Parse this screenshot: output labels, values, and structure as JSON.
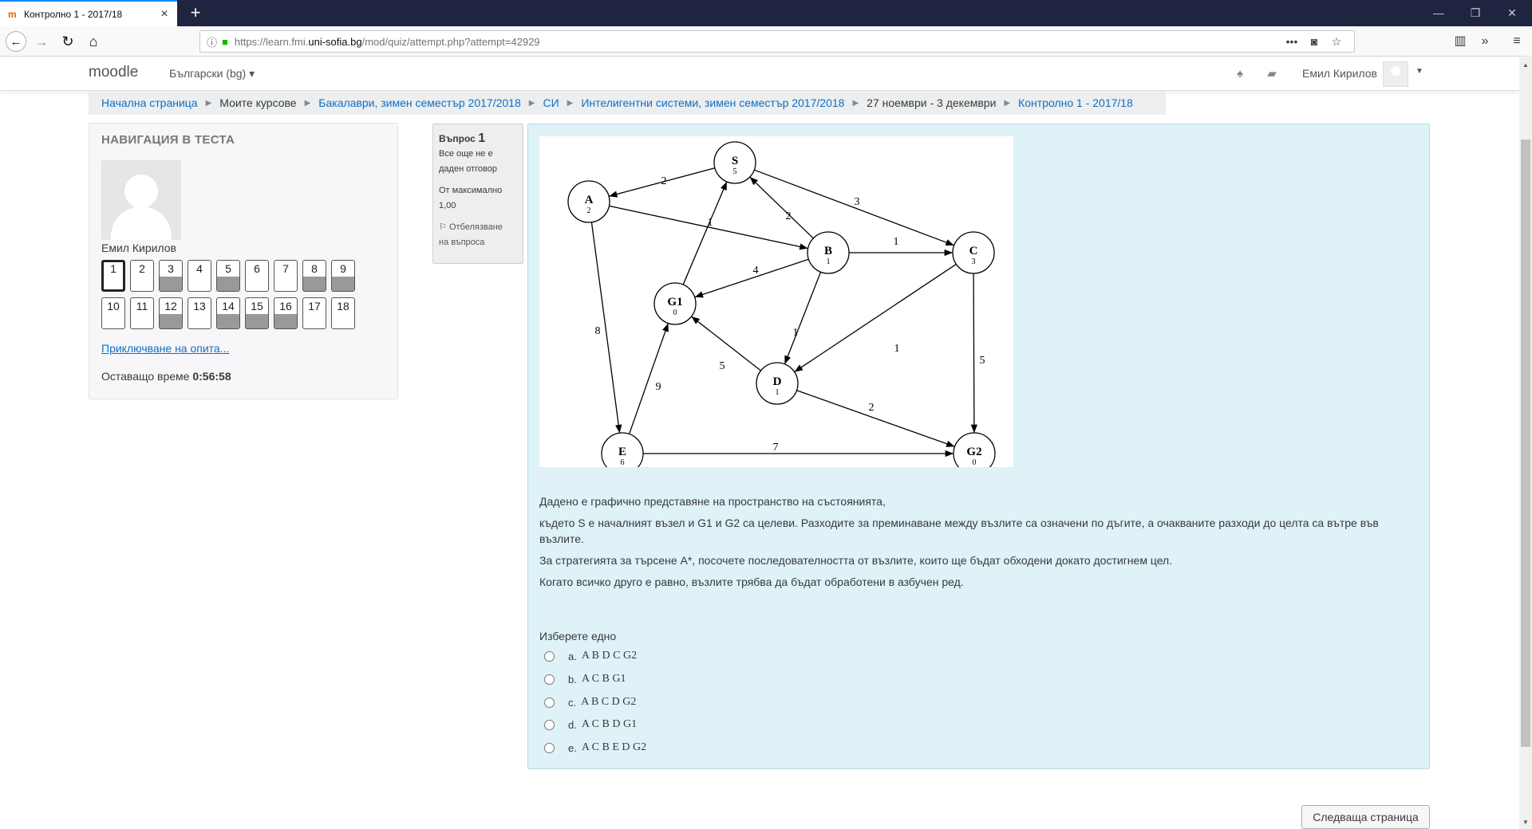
{
  "browser": {
    "tab_title": "Контролно 1 - 2017/18",
    "tab_icon": "moodle-favicon",
    "url_prefix": "https://learn.fmi.",
    "url_domain": "uni-sofia.bg",
    "url_path": "/mod/quiz/attempt.php?attempt=42929"
  },
  "header": {
    "brand": "moodle",
    "language": "Български (bg)",
    "user_name": "Емил Кирилов"
  },
  "breadcrumb": [
    {
      "label": "Начална страница",
      "link": true
    },
    {
      "label": "Моите курсове",
      "link": false
    },
    {
      "label": "Бакалаври, зимен семестър 2017/2018",
      "link": true
    },
    {
      "label": "СИ",
      "link": true
    },
    {
      "label": "Интелигентни системи, зимен семестър 2017/2018",
      "link": true
    },
    {
      "label": "27 ноември - 3 декември",
      "link": false
    },
    {
      "label": "Контролно 1 - 2017/18",
      "link": true
    }
  ],
  "quiz_nav": {
    "title": "НАВИГАЦИЯ В ТЕСТА",
    "user_name": "Емил Кирилов",
    "questions": [
      {
        "num": "1",
        "saved": false,
        "current": true
      },
      {
        "num": "2",
        "saved": false,
        "current": false
      },
      {
        "num": "3",
        "saved": true,
        "current": false
      },
      {
        "num": "4",
        "saved": false,
        "current": false
      },
      {
        "num": "5",
        "saved": true,
        "current": false
      },
      {
        "num": "6",
        "saved": false,
        "current": false
      },
      {
        "num": "7",
        "saved": false,
        "current": false
      },
      {
        "num": "8",
        "saved": true,
        "current": false
      },
      {
        "num": "9",
        "saved": true,
        "current": false
      },
      {
        "num": "10",
        "saved": false,
        "current": false
      },
      {
        "num": "11",
        "saved": false,
        "current": false
      },
      {
        "num": "12",
        "saved": true,
        "current": false
      },
      {
        "num": "13",
        "saved": false,
        "current": false
      },
      {
        "num": "14",
        "saved": true,
        "current": false
      },
      {
        "num": "15",
        "saved": true,
        "current": false
      },
      {
        "num": "16",
        "saved": true,
        "current": false
      },
      {
        "num": "17",
        "saved": false,
        "current": false
      },
      {
        "num": "18",
        "saved": false,
        "current": false
      }
    ],
    "finish_link": "Приключване на опита...",
    "timer_label": "Оставащо време",
    "timer_value": "0:56:58"
  },
  "question_info": {
    "label": "Въпрос",
    "number": "1",
    "status_line1": "Все още не е",
    "status_line2": "даден отговор",
    "grade_line1": "От максимално",
    "grade_line2": "1,00",
    "flag_line1": "Отбелязване",
    "flag_line2": "на въпроса"
  },
  "graph": {
    "nodes": [
      {
        "id": "S",
        "h": "5"
      },
      {
        "id": "A",
        "h": "2"
      },
      {
        "id": "B",
        "h": "1"
      },
      {
        "id": "C",
        "h": "3"
      },
      {
        "id": "G1",
        "h": "0"
      },
      {
        "id": "D",
        "h": "1"
      },
      {
        "id": "E",
        "h": "6"
      },
      {
        "id": "G2",
        "h": "0"
      }
    ],
    "edges": [
      {
        "from": "S",
        "to": "A",
        "w": "2"
      },
      {
        "from": "S",
        "to": "C",
        "w": "3"
      },
      {
        "from": "A",
        "to": "B",
        "w": "1"
      },
      {
        "from": "A",
        "to": "E",
        "w": "8"
      },
      {
        "from": "B",
        "to": "S",
        "w": "2"
      },
      {
        "from": "B",
        "to": "C",
        "w": "1"
      },
      {
        "from": "B",
        "to": "G1",
        "w": "4"
      },
      {
        "from": "B",
        "to": "D",
        "w": "1"
      },
      {
        "from": "G1",
        "to": "S",
        "w": ""
      },
      {
        "from": "C",
        "to": "D",
        "w": "1"
      },
      {
        "from": "C",
        "to": "G2",
        "w": "5"
      },
      {
        "from": "D",
        "to": "G1",
        "w": "5"
      },
      {
        "from": "D",
        "to": "G2",
        "w": "2"
      },
      {
        "from": "E",
        "to": "G1",
        "w": "9"
      },
      {
        "from": "E",
        "to": "G2",
        "w": "7"
      }
    ]
  },
  "question": {
    "paragraphs": [
      "Дадено е графично представяне на пространство на състоянията,",
      "където S е началният възел и G1 и G2 са целеви. Разходите за преминаване между възлите са означени по дъгите, а очакваните разходи до целта са вътре във възлите.",
      "За стратегията за търсене А*, посочете последователността от възлите, които ще бъдат обходени докато достигнем цел.",
      "Когато всичко друго е равно, възлите трябва да бъдат обработени в азбучен ред."
    ],
    "prompt": "Изберете едно",
    "options": [
      {
        "letter": "a.",
        "text": "A B D C G2"
      },
      {
        "letter": "b.",
        "text": "A C B G1"
      },
      {
        "letter": "c.",
        "text": "A B C D G2"
      },
      {
        "letter": "d.",
        "text": "A C B D G1"
      },
      {
        "letter": "e.",
        "text": "A C B E D G2"
      }
    ]
  },
  "next_button": "Следваща страница",
  "colors": {
    "accent": "#0f6fc5",
    "question_bg": "#def2f8",
    "tabbar": "#1f2540"
  }
}
